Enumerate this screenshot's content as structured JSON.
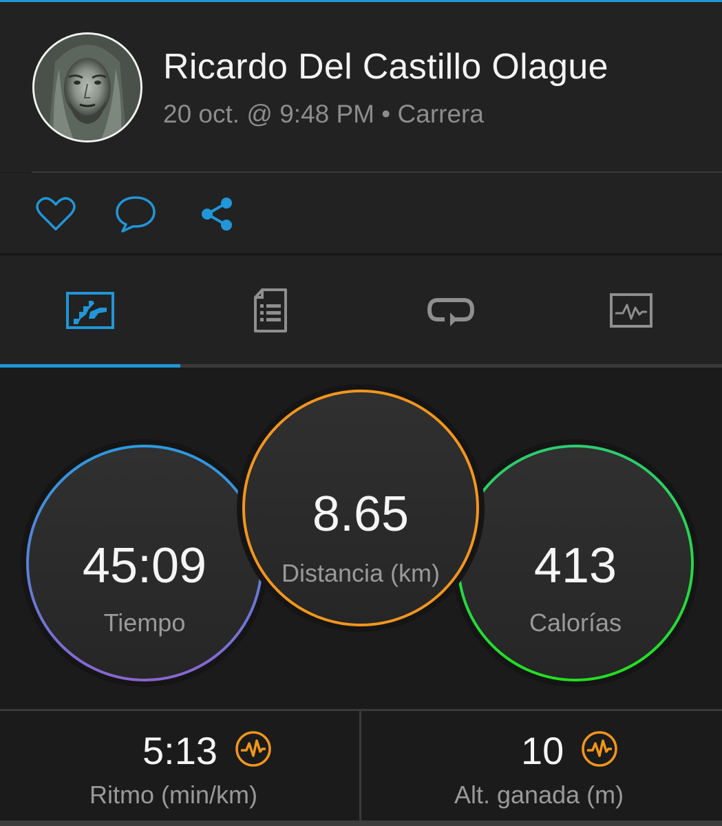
{
  "activity": {
    "user_name": "Ricardo Del Castillo Olague",
    "date": "20 oct. @ 9:48 PM",
    "separator": "•",
    "activity_type": "Carrera"
  },
  "actions": [
    {
      "id": "like",
      "icon": "heart-icon"
    },
    {
      "id": "comment",
      "icon": "comment-icon"
    },
    {
      "id": "share",
      "icon": "share-icon"
    }
  ],
  "tabs": [
    {
      "id": "overview",
      "icon": "overview-chart-icon",
      "active": true
    },
    {
      "id": "details",
      "icon": "document-list-icon",
      "active": false
    },
    {
      "id": "laps",
      "icon": "laps-loop-icon",
      "active": false
    },
    {
      "id": "graphs",
      "icon": "activity-graph-icon",
      "active": false
    }
  ],
  "circles": {
    "time": {
      "value": "45:09",
      "label": "Tiempo"
    },
    "distance": {
      "value": "8.65",
      "label": "Distancia (km)"
    },
    "calories": {
      "value": "413",
      "label": "Calorías"
    }
  },
  "metrics": {
    "pace": {
      "value": "5:13",
      "label": "Ritmo (min/km)",
      "icon": "activity-pulse-icon"
    },
    "elevation": {
      "value": "10",
      "label": "Alt. ganada (m)",
      "icon": "activity-pulse-icon"
    }
  },
  "colors": {
    "accent": "#2196d8",
    "time_ring_start": "#2b9be0",
    "time_ring_end": "#8a66d0",
    "distance_ring": "#f5961e",
    "calories_ring_start": "#2ecc71",
    "calories_ring_end": "#22e022",
    "metric_icon": "#f5961e",
    "text_primary": "#f5f5f5",
    "text_secondary": "#9a9a9a"
  }
}
